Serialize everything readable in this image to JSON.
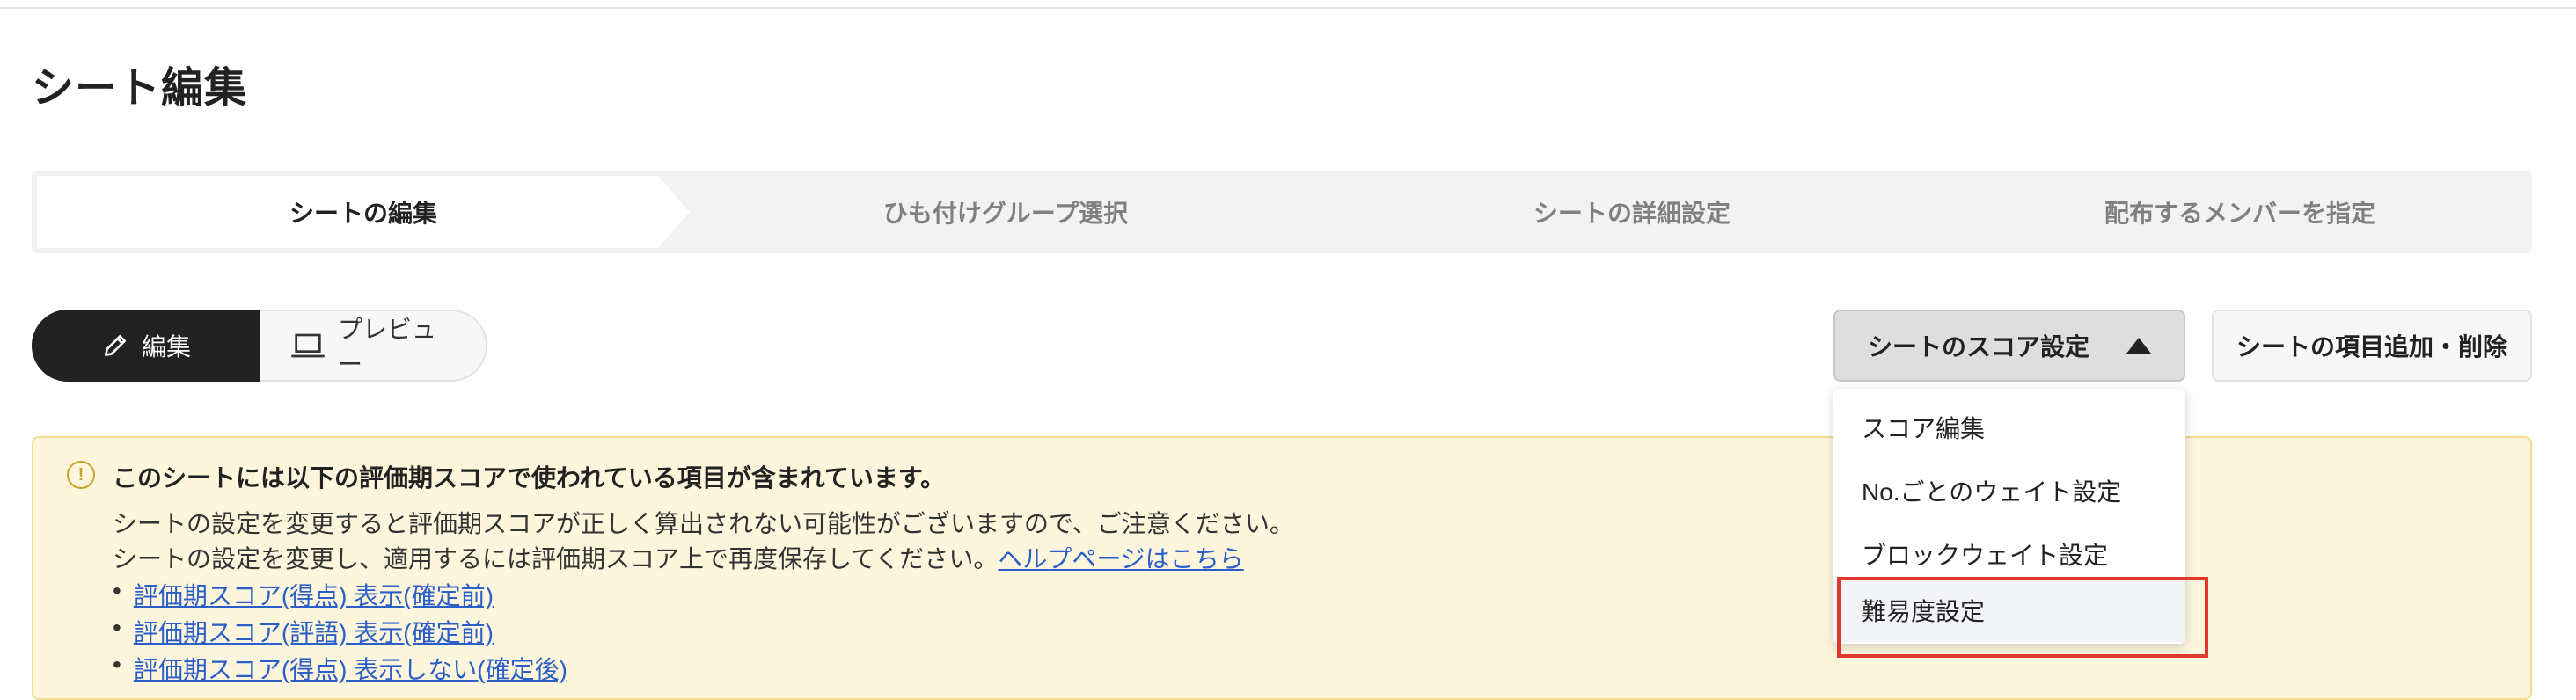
{
  "page": {
    "title": "シート編集"
  },
  "steps": [
    {
      "label": "シートの編集"
    },
    {
      "label": "ひも付けグループ選択"
    },
    {
      "label": "シートの詳細設定"
    },
    {
      "label": "配布するメンバーを指定"
    }
  ],
  "mode_toggle": {
    "edit_label": "編集",
    "preview_label": "プレビュー",
    "edit_icon": "pencil-icon",
    "preview_icon": "laptop-icon"
  },
  "toolbar": {
    "score_settings_label": "シートのスコア設定",
    "items_label": "シートの項目追加・削除"
  },
  "score_menu": {
    "items": [
      {
        "label": "スコア編集"
      },
      {
        "label": "No.ごとのウェイト設定"
      },
      {
        "label": "ブロックウェイト設定"
      },
      {
        "label": "難易度設定"
      }
    ]
  },
  "notice": {
    "title": "このシートには以下の評価期スコアで使われている項目が含まれています。",
    "line1": "シートの設定を変更すると評価期スコアが正しく算出されない可能性がございますので、ご注意ください。",
    "line2": "シートの設定を変更し、適用するには評価期スコア上で再度保存してください。",
    "help_link": "ヘルプページはこちら",
    "links": [
      {
        "label": "評価期スコア(得点) 表示(確定前)"
      },
      {
        "label": "評価期スコア(評語) 表示(確定前)"
      },
      {
        "label": "評価期スコア(得点) 表示しない(確定後)"
      }
    ]
  },
  "colors": {
    "dark": "#222222",
    "link": "#2a5ec8",
    "notice_bg": "#fdf6dd",
    "highlight": "#e0392b"
  }
}
